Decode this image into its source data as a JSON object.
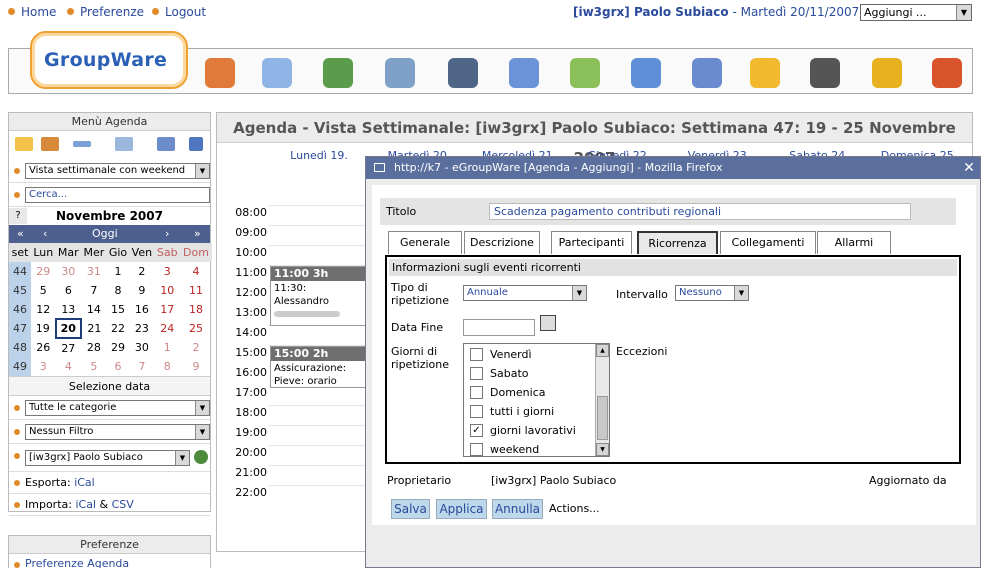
{
  "topbar": {
    "home": "Home",
    "prefs": "Preferenze",
    "logout": "Logout",
    "user": "[iw3grx] Paolo Subiaco",
    "date": " - Martedì 20/11/2007",
    "add_select": "Aggiungi ..."
  },
  "logo": {
    "text": "GroupWare"
  },
  "app_icons": [
    "home-icon",
    "calendar-icon",
    "addressbook-icon",
    "notes-icon",
    "projects-icon",
    "timesheet-icon",
    "infolog-icon",
    "filemanager-icon",
    "wiki-icon",
    "bookmarks-icon",
    "news-icon",
    "help-icon",
    "logout-icon"
  ],
  "sidebar": {
    "header": "Menù Agenda",
    "view_select": "Vista settimanale con weekend",
    "search_placeholder": "Cerca...",
    "cal_title": "Novembre 2007",
    "cal_q": "?",
    "cal_nav_prev2": "«",
    "cal_nav_prev": "‹",
    "cal_nav_label": "Oggi",
    "cal_nav_next": "›",
    "cal_nav_next2": "»",
    "cal_headers": [
      "set",
      "Lun",
      "Mar",
      "Mer",
      "Gio",
      "Ven",
      "Sab",
      "Dom"
    ],
    "cal_rows": [
      [
        "44",
        "29",
        "30",
        "31",
        "1",
        "2",
        "3",
        "4"
      ],
      [
        "45",
        "5",
        "6",
        "7",
        "8",
        "9",
        "10",
        "11"
      ],
      [
        "46",
        "12",
        "13",
        "14",
        "15",
        "16",
        "17",
        "18"
      ],
      [
        "47",
        "19",
        "20",
        "21",
        "22",
        "23",
        "24",
        "25"
      ],
      [
        "48",
        "26",
        "27",
        "28",
        "29",
        "30",
        "1",
        "2"
      ],
      [
        "49",
        "3",
        "4",
        "5",
        "6",
        "7",
        "8",
        "9"
      ]
    ],
    "sel_data": "Selezione data",
    "categories": "Tutte le categorie",
    "filter": "Nessun Filtro",
    "owner": "[iw3grx] Paolo Subiaco",
    "export_label": "Esporta: ",
    "export_link": "iCal",
    "import_label": "Importa: ",
    "import_ical": "iCal",
    "import_amp": " & ",
    "import_csv": "CSV",
    "pref_header": "Preferenze",
    "pref_link": "Preferenze Agenda"
  },
  "main": {
    "title": "Agenda - Vista Settimanale: [iw3grx] Paolo Subiaco: Settimana 47: 19 - 25 Novembre 2007",
    "days": [
      "Lunedì 19.",
      "Martedì 20.",
      "Mercoledì 21.",
      "Giovedì 22.",
      "Venerdì 23.",
      "Sabato 24.",
      "Domenica 25."
    ],
    "times": [
      "08:00",
      "09:00",
      "10:00",
      "11:00",
      "12:00",
      "13:00",
      "14:00",
      "15:00",
      "16:00",
      "17:00",
      "18:00",
      "19:00",
      "20:00",
      "21:00",
      "22:00"
    ],
    "event1": {
      "head": "11:00 3h",
      "l1": "11:30:",
      "l2": "Alessandro"
    },
    "event2": {
      "head": "15:00 2h",
      "l1": "Assicurazione:",
      "l2": "Pieve: orario"
    }
  },
  "popup": {
    "window_title": "http://k7 - eGroupWare [Agenda - Aggiungi] - Mozilla Firefox",
    "close": "✕",
    "title_label": "Titolo",
    "title_value": "Scadenza pagamento contributi regionali",
    "tabs": [
      "Generale",
      "Descrizione",
      "Partecipanti",
      "Ricorrenza",
      "Collegamenti",
      "Allarmi"
    ],
    "info_head": "Informazioni sugli eventi ricorrenti",
    "type_label_1": "Tipo di",
    "type_label_2": "ripetizione",
    "type_value": "Annuale",
    "interval_label": "Intervallo",
    "interval_value": "Nessuno",
    "end_label": "Data Fine",
    "days_label_1": "Giorni di",
    "days_label_2": "ripetizione",
    "exceptions_label": "Eccezioni",
    "days_items": [
      {
        "label": "Venerdì",
        "checked": false
      },
      {
        "label": "Sabato",
        "checked": false
      },
      {
        "label": "Domenica",
        "checked": false
      },
      {
        "label": "tutti i giorni",
        "checked": false
      },
      {
        "label": "giorni lavorativi",
        "checked": true
      },
      {
        "label": "weekend",
        "checked": false
      }
    ],
    "owner_label": "Proprietario",
    "owner_value": "[iw3grx] Paolo Subiaco",
    "updated_label": "Aggiornato da",
    "btn_save": "Salva",
    "btn_apply": "Applica",
    "btn_cancel": "Annulla",
    "actions": "Actions..."
  }
}
